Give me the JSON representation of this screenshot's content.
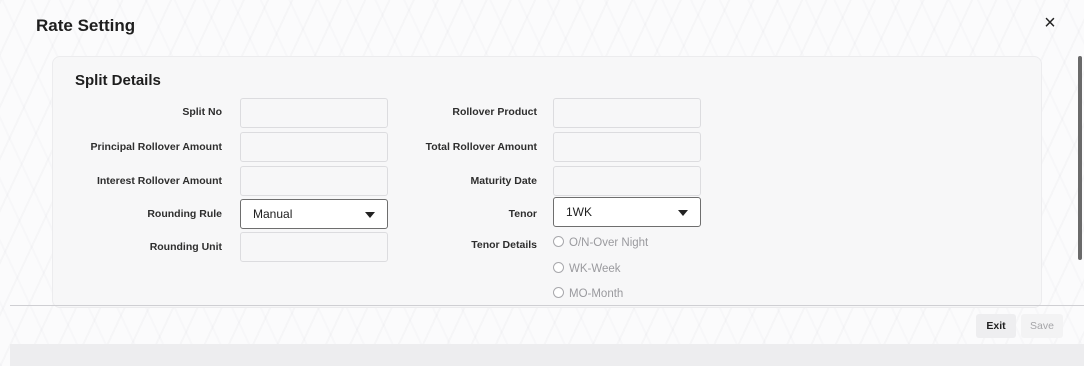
{
  "dialog": {
    "title": "Rate Setting",
    "close_icon": "×"
  },
  "section": {
    "title": "Split Details"
  },
  "fields": {
    "split_no": {
      "label": "Split No",
      "value": ""
    },
    "principal_rollover_amount": {
      "label": "Principal Rollover Amount",
      "value": ""
    },
    "interest_rollover_amount": {
      "label": "Interest Rollover Amount",
      "value": ""
    },
    "rounding_rule": {
      "label": "Rounding Rule",
      "value": "Manual"
    },
    "rounding_unit": {
      "label": "Rounding Unit",
      "value": ""
    },
    "rollover_product": {
      "label": "Rollover Product",
      "value": ""
    },
    "total_rollover_amount": {
      "label": "Total Rollover Amount",
      "value": ""
    },
    "maturity_date": {
      "label": "Maturity Date",
      "value": ""
    },
    "tenor": {
      "label": "Tenor",
      "value": "1WK"
    },
    "tenor_details": {
      "label": "Tenor Details",
      "options": [
        "O/N-Over Night",
        "WK-Week",
        "MO-Month"
      ]
    }
  },
  "footer": {
    "exit_label": "Exit",
    "save_label": "Save"
  }
}
